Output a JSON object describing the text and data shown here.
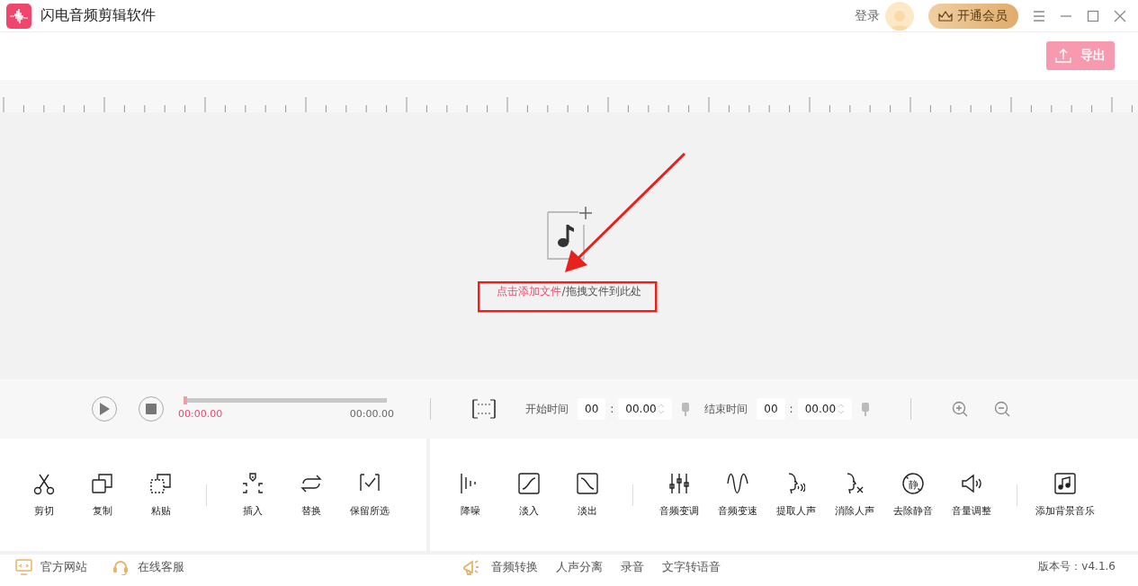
{
  "app": {
    "title": "闪电音频剪辑软件"
  },
  "header": {
    "login": "登录",
    "vip_button": "开通会员"
  },
  "export_button": "导出",
  "drop_zone": {
    "add_link": "点击添加文件",
    "hint": "/拖拽文件到此处"
  },
  "player": {
    "progress": {
      "level": 0
    },
    "current_time": "00:00.00",
    "total_time": "00:00.00"
  },
  "range": [
    {
      "label": "开始时间",
      "minutes": "00",
      "separator": ":",
      "seconds": "00.00"
    },
    {
      "label": "结束时间",
      "minutes": "00",
      "separator": ":",
      "seconds": "00.00"
    }
  ],
  "tool_panels": [
    [
      [
        {
          "kind": "cut",
          "label": "剪切"
        },
        {
          "kind": "copy",
          "label": "复制"
        },
        {
          "kind": "paste",
          "label": "粘贴"
        }
      ],
      [
        {
          "kind": "insert",
          "label": "插入"
        },
        {
          "kind": "replace",
          "label": "替换"
        },
        {
          "kind": "keep",
          "label": "保留所选"
        }
      ]
    ],
    [
      [
        {
          "kind": "denoise",
          "label": "降噪"
        },
        {
          "kind": "fadein",
          "label": "淡入"
        },
        {
          "kind": "fadeout",
          "label": "淡出"
        }
      ],
      [
        {
          "kind": "pitch",
          "label": "音频变调"
        },
        {
          "kind": "speed",
          "label": "音频变速"
        },
        {
          "kind": "extract",
          "label": "提取人声"
        },
        {
          "kind": "remove",
          "label": "消除人声"
        },
        {
          "kind": "silence",
          "label": "去除静音",
          "icon_text": "静"
        },
        {
          "kind": "volume",
          "label": "音量调整"
        }
      ],
      [
        {
          "kind": "music",
          "label": "添加背景音乐"
        }
      ]
    ]
  ],
  "footer": {
    "links": [
      {
        "kind": "website",
        "label": "官方网站"
      },
      {
        "kind": "support",
        "label": "在线客服"
      }
    ],
    "features": [
      "音频转换",
      "人声分离",
      "录音",
      "文字转语音"
    ],
    "version": "版本号：v4.1.6"
  }
}
